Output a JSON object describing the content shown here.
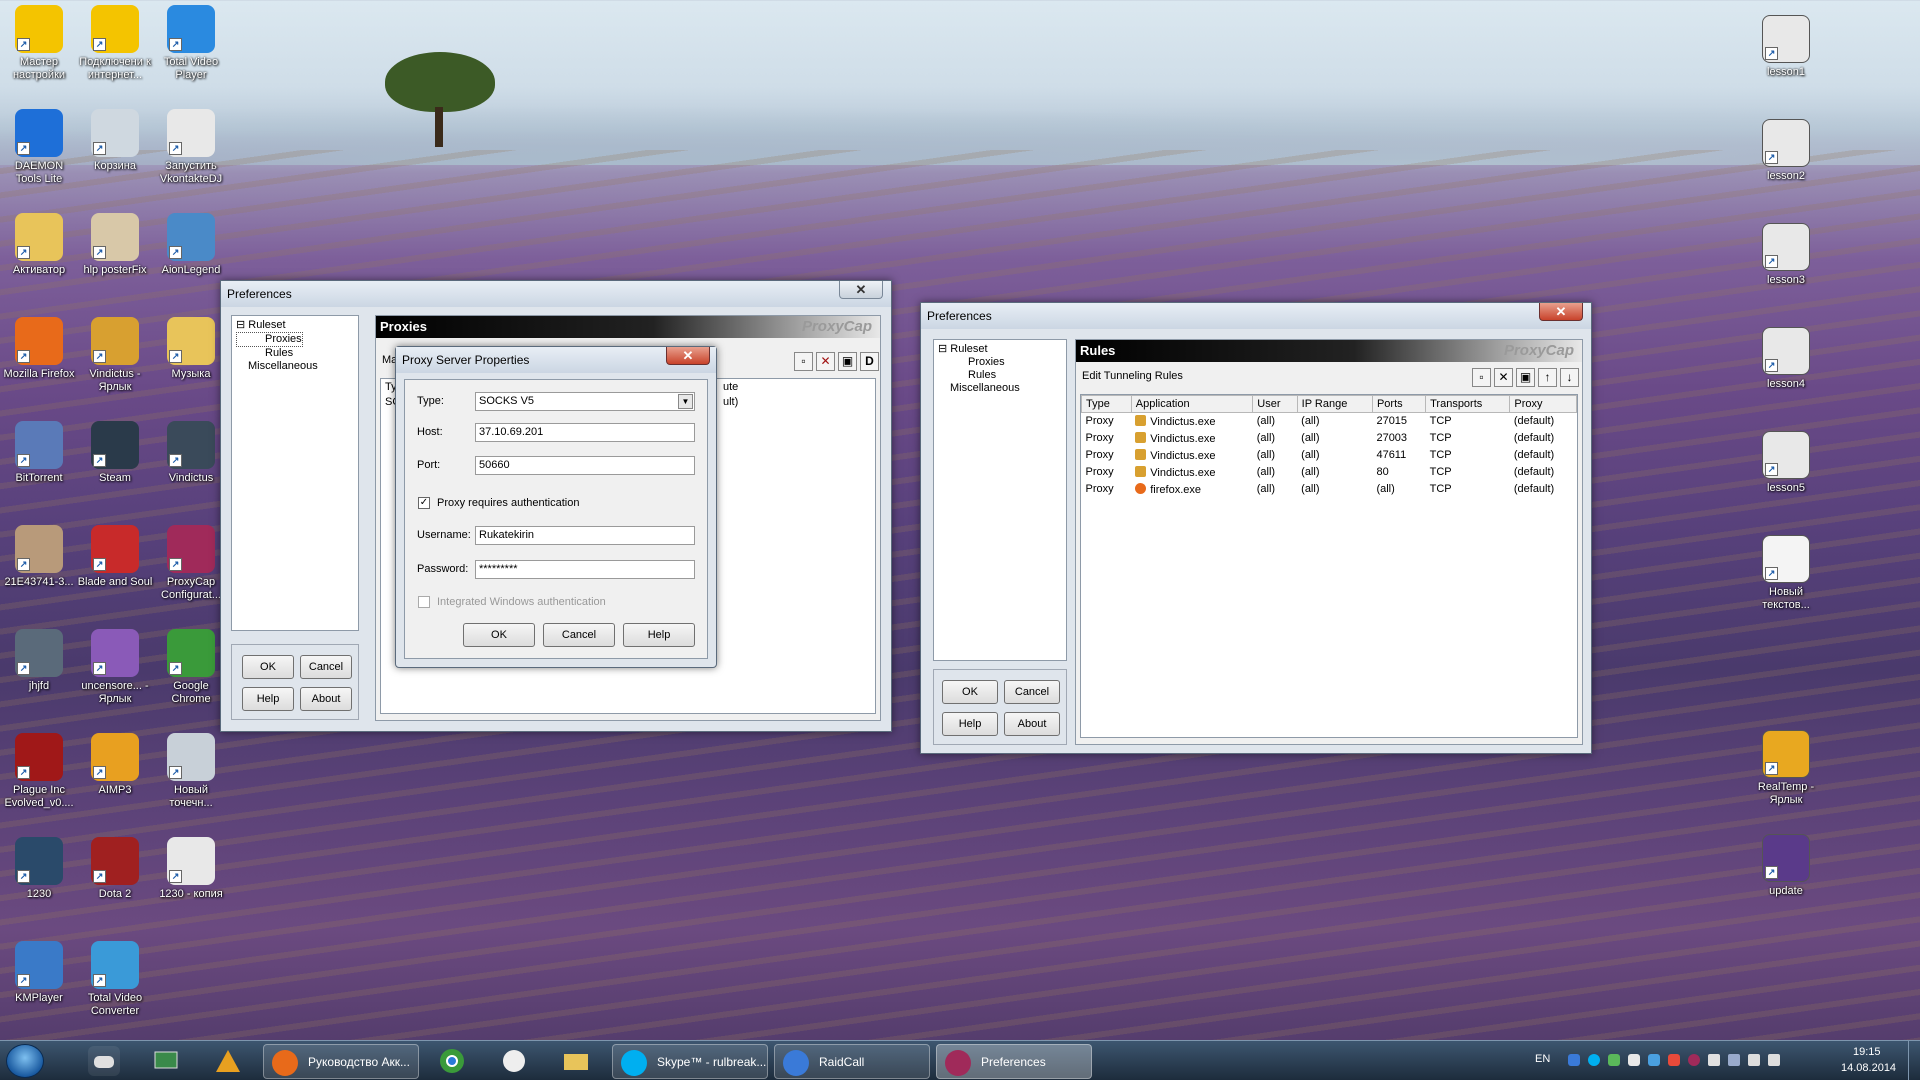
{
  "desktop": {
    "left_icons": [
      {
        "label": "Мастер настройки",
        "color": "#f4c400",
        "icon": "beeline-icon"
      },
      {
        "label": "Подключени к интернет...",
        "color": "#f4c400",
        "icon": "beeline-icon"
      },
      {
        "label": "Total Video Player",
        "color": "#2a8ae0",
        "icon": "play-icon"
      },
      {
        "label": "DAEMON Tools Lite",
        "color": "#1e6fd8",
        "icon": "lightning-icon"
      },
      {
        "label": "Корзина",
        "color": "#cfd8e0",
        "icon": "recycle-bin-icon"
      },
      {
        "label": "Запустить VkontakteDJ",
        "color": "#e8e8e8",
        "icon": "headphones-icon"
      },
      {
        "label": "Активатор",
        "color": "#e8c45a",
        "icon": "folder-icon"
      },
      {
        "label": "hlp posterFix",
        "color": "#d8c8a8",
        "icon": "anime-icon"
      },
      {
        "label": "AionLegend",
        "color": "#4a8ac8",
        "icon": "aion-icon"
      },
      {
        "label": "Mozilla Firefox",
        "color": "#e86a1a",
        "icon": "firefox-icon"
      },
      {
        "label": "Vindictus - Ярлык",
        "color": "#d8a030",
        "icon": "vindictus-icon"
      },
      {
        "label": "Музыка",
        "color": "#e8c45a",
        "icon": "folder-icon"
      },
      {
        "label": "BitTorrent",
        "color": "#5a7ab8",
        "icon": "bittorrent-icon"
      },
      {
        "label": "Steam",
        "color": "#2a3a4a",
        "icon": "steam-icon"
      },
      {
        "label": "Vindictus",
        "color": "#3a4a5a",
        "icon": "vindictus-icon"
      },
      {
        "label": "21E43741-3...",
        "color": "#b89a7a",
        "icon": "image-icon"
      },
      {
        "label": "Blade and Soul",
        "color": "#c82a2a",
        "icon": "blade-soul-icon"
      },
      {
        "label": "ProxyCap Configurat...",
        "color": "#a02a5a",
        "icon": "proxycap-icon"
      },
      {
        "label": "jhjfd",
        "color": "#5a6a7a",
        "icon": "file-icon"
      },
      {
        "label": "uncensore... - Ярлык",
        "color": "#8a5ab8",
        "icon": "winrar-icon"
      },
      {
        "label": "Google Chrome",
        "color": "#3a9a3a",
        "icon": "chrome-icon"
      },
      {
        "label": "Plague Inc Evolved_v0....",
        "color": "#a01818",
        "icon": "biohazard-icon"
      },
      {
        "label": "AIMP3",
        "color": "#e8a020",
        "icon": "aimp-icon"
      },
      {
        "label": "Новый точечн...",
        "color": "#c8d0d8",
        "icon": "bitmap-icon"
      },
      {
        "label": "1230",
        "color": "#2a4a6a",
        "icon": "game-icon"
      },
      {
        "label": "Dota 2",
        "color": "#a02020",
        "icon": "dota-icon"
      },
      {
        "label": "1230 - копия",
        "color": "#e8e8e8",
        "icon": "file-icon"
      },
      {
        "label": "KMPlayer",
        "color": "#3a7ac8",
        "icon": "kmplayer-icon"
      },
      {
        "label": "Total Video Converter",
        "color": "#3a9ad8",
        "icon": "converter-icon"
      }
    ],
    "right_icons": [
      {
        "label": "lesson1",
        "color": "#e8e8e8",
        "icon": "video-file-icon"
      },
      {
        "label": "lesson2",
        "color": "#e8e8e8",
        "icon": "video-file-icon"
      },
      {
        "label": "lesson3",
        "color": "#e8e8e8",
        "icon": "video-file-icon"
      },
      {
        "label": "lesson4",
        "color": "#e8e8e8",
        "icon": "video-file-icon"
      },
      {
        "label": "lesson5",
        "color": "#e8e8e8",
        "icon": "video-file-icon"
      },
      {
        "label": "Новый текстов...",
        "color": "#f4f4f4",
        "icon": "text-file-icon"
      },
      {
        "label": "RealTemp - Ярлык",
        "color": "#e8a820",
        "icon": "realtemp-icon"
      },
      {
        "label": "update",
        "color": "#5a3a8a",
        "icon": "winrar-icon"
      }
    ]
  },
  "pref_left": {
    "title": "Preferences",
    "tree": {
      "root": "Ruleset",
      "children": [
        "Proxies",
        "Rules"
      ],
      "misc": "Miscellaneous"
    },
    "header": "Proxies",
    "brand": "ProxyCap",
    "partial_header_left": "Ty",
    "partial_row_left": "SO",
    "partial_col": "ute",
    "partial_cell": "ult)",
    "partial_toolbar_label": "Ma",
    "buttons": {
      "ok": "OK",
      "cancel": "Cancel",
      "help": "Help",
      "about": "About"
    }
  },
  "proxy_dialog": {
    "title": "Proxy Server Properties",
    "type_label": "Type:",
    "type_value": "SOCKS V5",
    "host_label": "Host:",
    "host_value": "37.10.69.201",
    "port_label": "Port:",
    "port_value": "50660",
    "auth_label": "Proxy requires authentication",
    "username_label": "Username:",
    "username_value": "Rukatekirin",
    "password_label": "Password:",
    "password_value": "*********",
    "windows_auth_label": "Integrated Windows authentication",
    "buttons": {
      "ok": "OK",
      "cancel": "Cancel",
      "help": "Help"
    }
  },
  "pref_right": {
    "title": "Preferences",
    "tree": {
      "root": "Ruleset",
      "children": [
        "Proxies",
        "Rules"
      ],
      "misc": "Miscellaneous"
    },
    "header": "Rules",
    "brand": "ProxyCap",
    "toolbar_label": "Edit Tunneling Rules",
    "columns": [
      "Type",
      "Application",
      "User",
      "IP Range",
      "Ports",
      "Transports",
      "Proxy"
    ],
    "rows": [
      [
        "Proxy",
        "Vindictus.exe",
        "(all)",
        "(all)",
        "27015",
        "TCP",
        "(default)"
      ],
      [
        "Proxy",
        "Vindictus.exe",
        "(all)",
        "(all)",
        "27003",
        "TCP",
        "(default)"
      ],
      [
        "Proxy",
        "Vindictus.exe",
        "(all)",
        "(all)",
        "47611",
        "TCP",
        "(default)"
      ],
      [
        "Proxy",
        "Vindictus.exe",
        "(all)",
        "(all)",
        "80",
        "TCP",
        "(default)"
      ],
      [
        "Proxy",
        "firefox.exe",
        "(all)",
        "(all)",
        "(all)",
        "TCP",
        "(default)"
      ]
    ],
    "buttons": {
      "ok": "OK",
      "cancel": "Cancel",
      "help": "Help",
      "about": "About"
    }
  },
  "taskbar": {
    "tasks": [
      {
        "label": "Руководство Акк...",
        "icon": "firefox-icon",
        "color": "#e86a1a"
      },
      {
        "label": "Skype™ - rulbreak...",
        "icon": "skype-icon",
        "color": "#00aff0"
      },
      {
        "label": "RaidCall",
        "icon": "raidcall-icon",
        "color": "#3a7ad8"
      },
      {
        "label": "Preferences",
        "icon": "proxycap-icon",
        "color": "#a02a5a"
      }
    ],
    "lang": "EN",
    "time": "19:15",
    "date": "14.08.2014"
  }
}
